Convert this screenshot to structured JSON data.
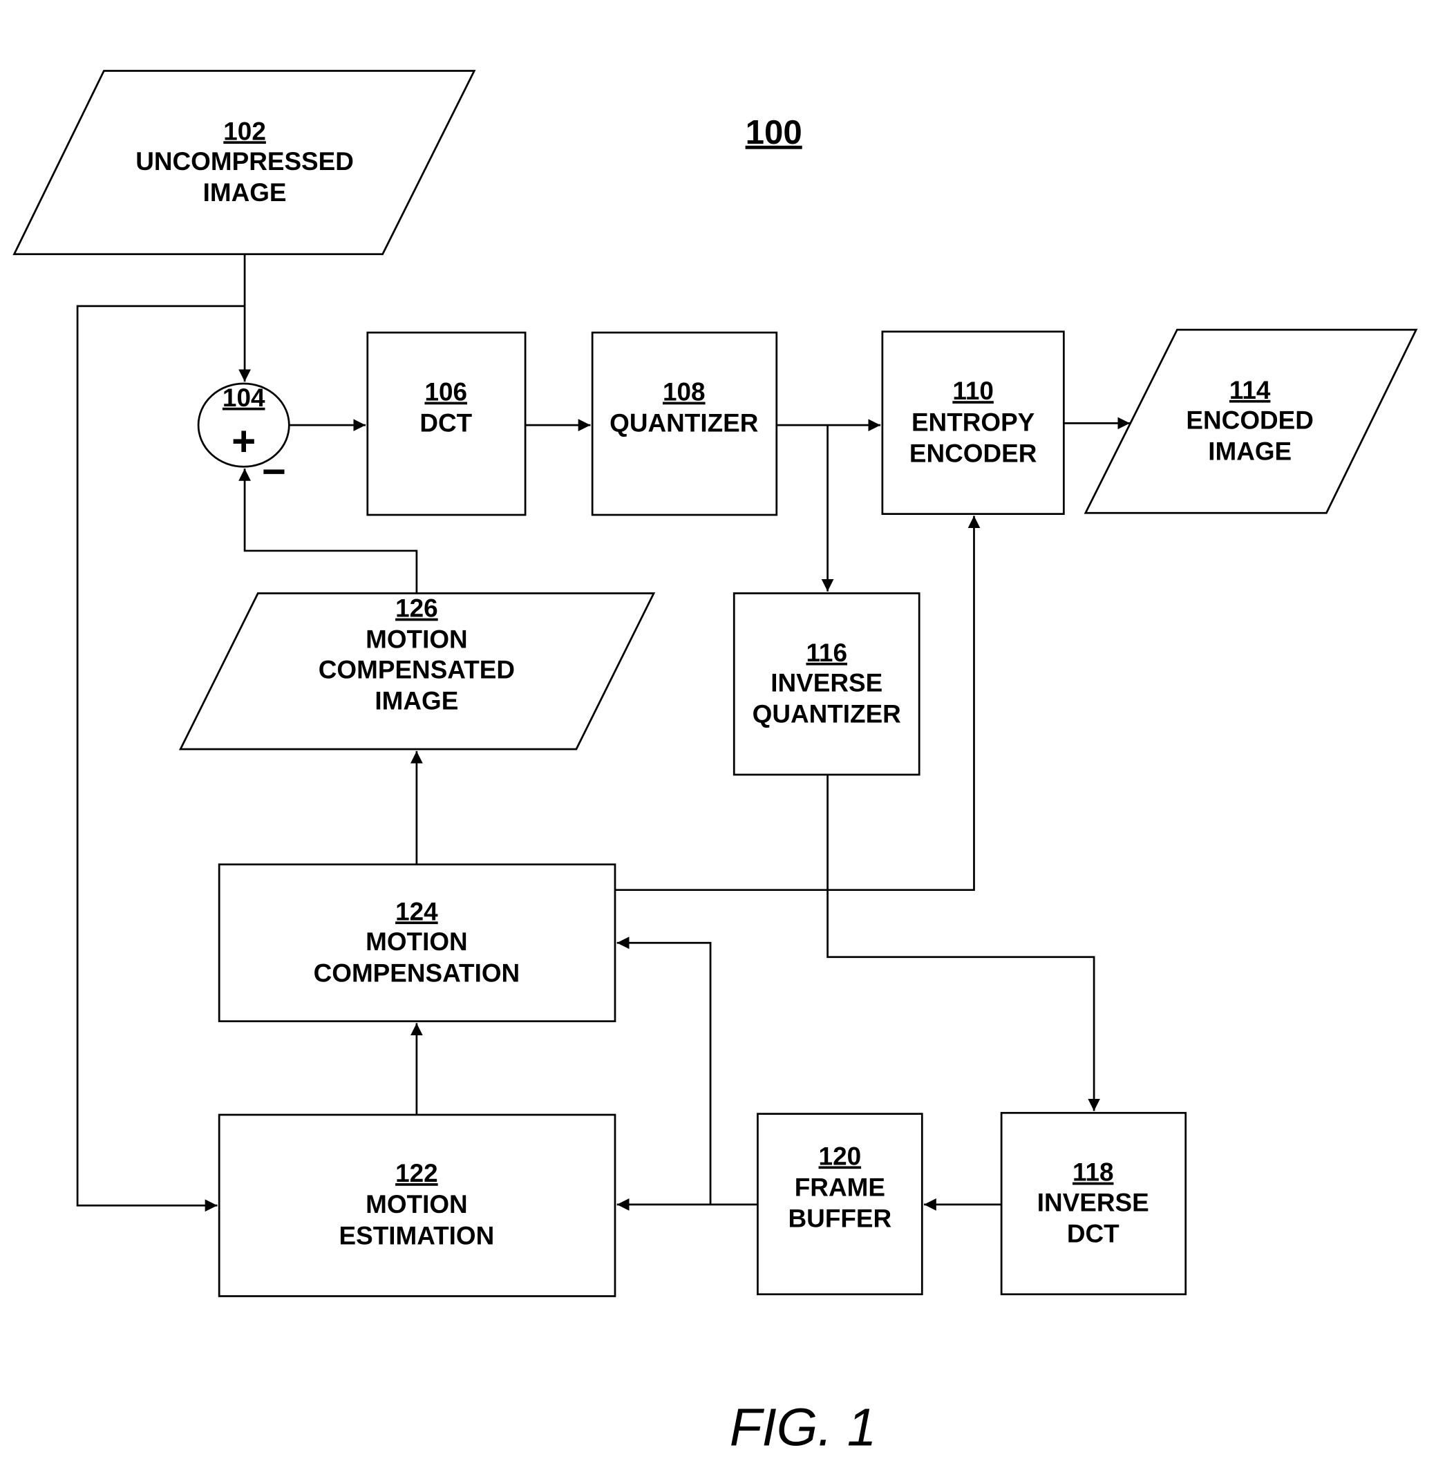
{
  "figure": {
    "number": "100",
    "caption": "FIG. 1"
  },
  "nodes": {
    "uncompressed_image": {
      "ref": "102",
      "lines": [
        "UNCOMPRESSED",
        "IMAGE"
      ]
    },
    "summer": {
      "ref": "104",
      "plus": "+",
      "minus": "−"
    },
    "dct": {
      "ref": "106",
      "lines": [
        "DCT"
      ]
    },
    "quantizer": {
      "ref": "108",
      "lines": [
        "QUANTIZER"
      ]
    },
    "entropy_encoder": {
      "ref": "110",
      "lines": [
        "ENTROPY",
        "ENCODER"
      ]
    },
    "encoded_image": {
      "ref": "114",
      "lines": [
        "ENCODED",
        "IMAGE"
      ]
    },
    "inverse_quantizer": {
      "ref": "116",
      "lines": [
        "INVERSE",
        "QUANTIZER"
      ]
    },
    "inverse_dct": {
      "ref": "118",
      "lines": [
        "INVERSE",
        "DCT"
      ]
    },
    "frame_buffer": {
      "ref": "120",
      "lines": [
        "FRAME",
        "BUFFER"
      ]
    },
    "motion_estimation": {
      "ref": "122",
      "lines": [
        "MOTION",
        "ESTIMATION"
      ]
    },
    "motion_compensation": {
      "ref": "124",
      "lines": [
        "MOTION",
        "COMPENSATION"
      ]
    },
    "motion_compensated_image": {
      "ref": "126",
      "lines": [
        "MOTION",
        "COMPENSATED",
        "IMAGE"
      ]
    }
  },
  "connections": [
    {
      "from": "uncompressed_image",
      "to": "summer",
      "sign": "+"
    },
    {
      "from": "uncompressed_image",
      "to": "motion_estimation"
    },
    {
      "from": "summer",
      "to": "dct"
    },
    {
      "from": "dct",
      "to": "quantizer"
    },
    {
      "from": "quantizer",
      "to": "entropy_encoder"
    },
    {
      "from": "quantizer",
      "to": "inverse_quantizer"
    },
    {
      "from": "entropy_encoder",
      "to": "encoded_image"
    },
    {
      "from": "inverse_quantizer",
      "to": "inverse_dct"
    },
    {
      "from": "inverse_dct",
      "to": "frame_buffer"
    },
    {
      "from": "frame_buffer",
      "to": "motion_estimation"
    },
    {
      "from": "frame_buffer",
      "to": "motion_compensation"
    },
    {
      "from": "motion_estimation",
      "to": "motion_compensation"
    },
    {
      "from": "motion_compensation",
      "to": "motion_compensated_image"
    },
    {
      "from": "motion_compensation",
      "to": "entropy_encoder"
    },
    {
      "from": "motion_compensated_image",
      "to": "summer",
      "sign": "−"
    }
  ]
}
